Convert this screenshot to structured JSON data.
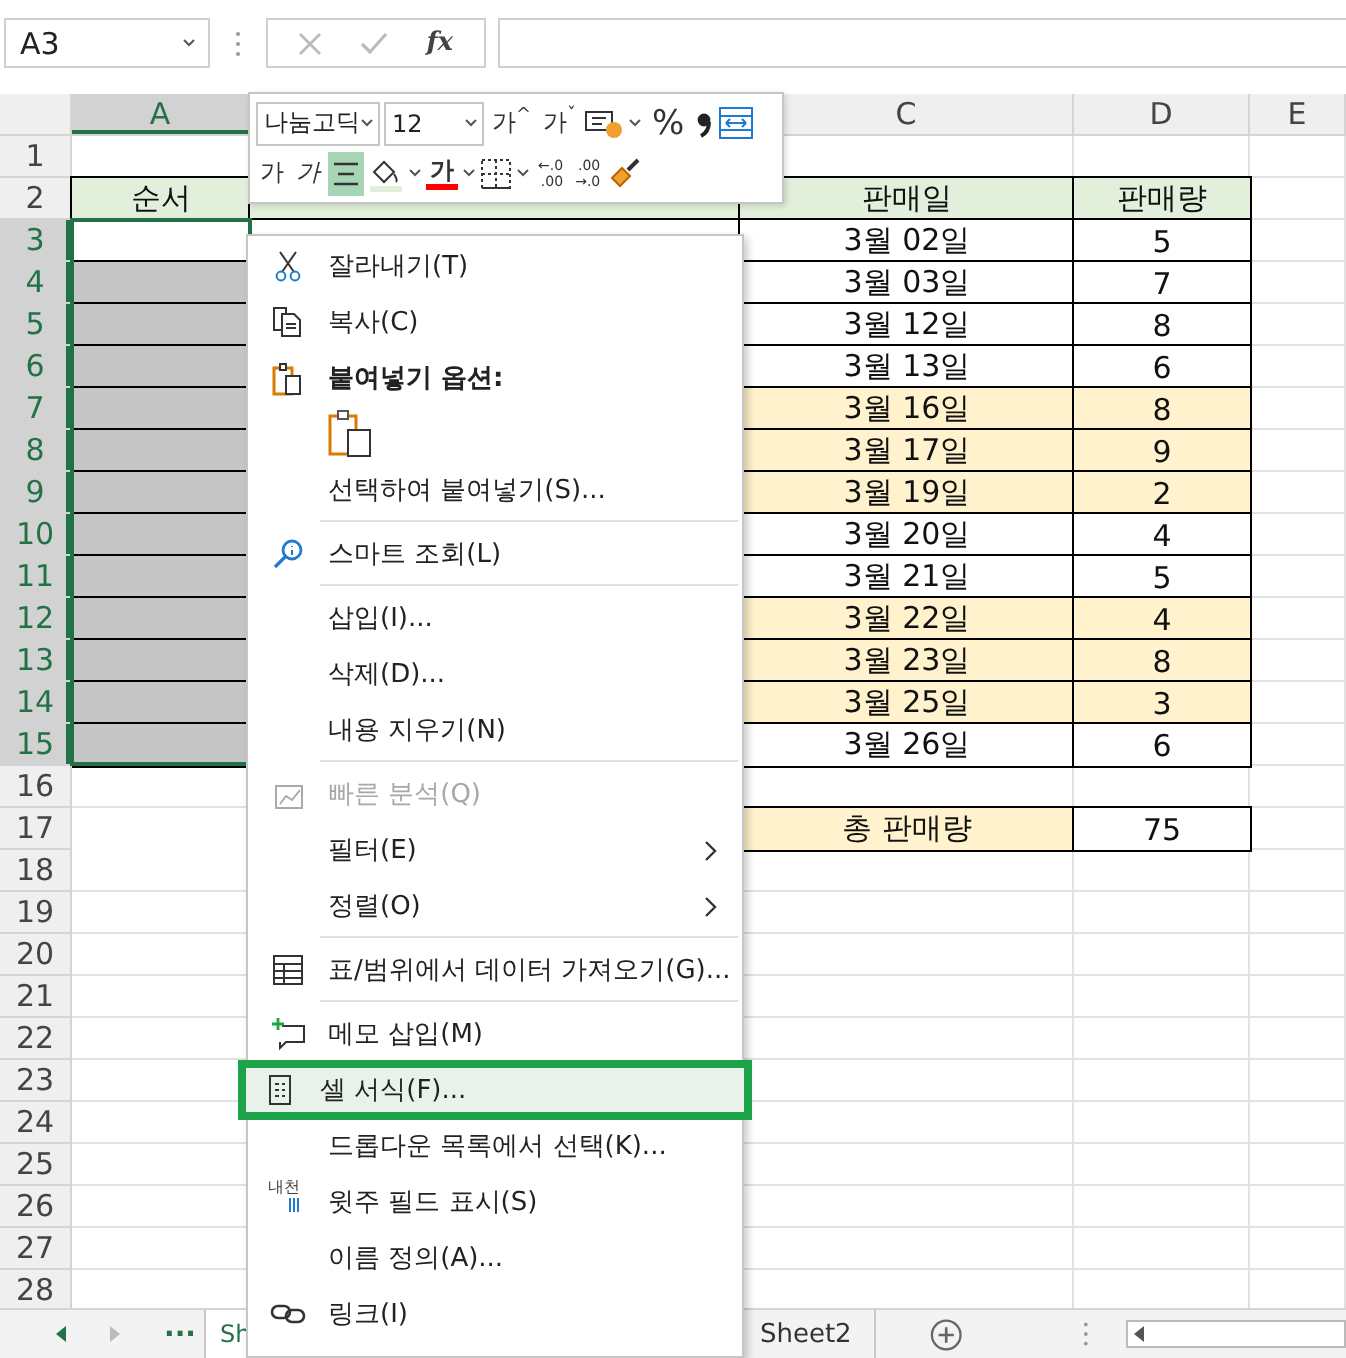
{
  "name_box": "A3",
  "formula_bar": {
    "fx_label": "fx"
  },
  "mini_toolbar": {
    "font": "나눔고딕",
    "size": "12",
    "grow_label": "가",
    "grow_mark": "^",
    "shrink_label": "가",
    "shrink_mark": "ˇ",
    "percent_label": "%",
    "bold_label": "가",
    "italic_label": "가",
    "align_center_selected": true,
    "font_color_label": "가",
    "increase_decimal": {
      "arrow": "←",
      "top": ".0",
      "bottom": ".00"
    },
    "decrease_decimal": {
      "arrow": "→",
      "top": ".00",
      "bottom": ".0"
    }
  },
  "columns": [
    {
      "label": "A",
      "selected": true
    },
    {},
    {
      "label": "C",
      "selected": false
    },
    {
      "label": "D",
      "selected": false
    },
    {
      "label": "E",
      "selected": false
    }
  ],
  "rows": [
    {
      "number": "1",
      "selected": false
    },
    {
      "number": "2",
      "selected": false,
      "cells": [
        {
          "text": "순서",
          "color": "#e2efda",
          "bordered": true
        },
        {
          "color": "#e2efda",
          "bordered": true
        },
        {
          "text": "판매일",
          "color": "#e2efda",
          "bordered": true
        },
        {
          "text": "판매량",
          "color": "#e2efda",
          "bordered": true
        }
      ]
    },
    {
      "number": "3",
      "selected": true,
      "cells": [
        {
          "color": "#ffffff",
          "bordered": true
        },
        {
          "color": "#ffffff",
          "bordered": true
        },
        {
          "text": "3월 02일",
          "color": "#ffffff",
          "bordered": true
        },
        {
          "text": "5",
          "color": "#ffffff",
          "bordered": true
        }
      ]
    },
    {
      "number": "4",
      "selected": true,
      "cells": [
        {
          "color": "#c6c6c6",
          "bordered": true
        },
        {
          "text": "3월 03일",
          "color": "#ffffff",
          "bordered": true
        },
        {
          "text": "7",
          "color": "#ffffff",
          "bordered": true
        }
      ]
    },
    {
      "number": "5",
      "selected": true,
      "cells": [
        {
          "color": "#c6c6c6",
          "bordered": true
        },
        {
          "text": "3월 12일",
          "color": "#ffffff",
          "bordered": true
        },
        {
          "text": "8",
          "color": "#ffffff",
          "bordered": true
        }
      ]
    },
    {
      "number": "6",
      "selected": true,
      "cells": [
        {
          "color": "#c6c6c6",
          "bordered": true
        },
        {
          "text": "3월 13일",
          "color": "#ffffff",
          "bordered": true
        },
        {
          "text": "6",
          "color": "#ffffff",
          "bordered": true
        }
      ]
    },
    {
      "number": "7",
      "selected": true,
      "cells": [
        {
          "color": "#c6c6c6",
          "bordered": true
        },
        {
          "text": "3월 16일",
          "color": "#fff2cc",
          "bordered": true
        },
        {
          "text": "8",
          "color": "#fff2cc",
          "bordered": true
        }
      ]
    },
    {
      "number": "8",
      "selected": true,
      "cells": [
        {
          "color": "#c6c6c6",
          "bordered": true
        },
        {
          "text": "3월 17일",
          "color": "#fff2cc",
          "bordered": true
        },
        {
          "text": "9",
          "color": "#fff2cc",
          "bordered": true
        }
      ]
    },
    {
      "number": "9",
      "selected": true,
      "cells": [
        {
          "color": "#c6c6c6",
          "bordered": true
        },
        {
          "text": "3월 19일",
          "color": "#fff2cc",
          "bordered": true
        },
        {
          "text": "2",
          "color": "#fff2cc",
          "bordered": true
        }
      ]
    },
    {
      "number": "10",
      "selected": true,
      "cells": [
        {
          "color": "#c6c6c6",
          "bordered": true
        },
        {
          "text": "3월 20일",
          "color": "#ffffff",
          "bordered": true
        },
        {
          "text": "4",
          "color": "#ffffff",
          "bordered": true
        }
      ]
    },
    {
      "number": "11",
      "selected": true,
      "cells": [
        {
          "color": "#c6c6c6",
          "bordered": true
        },
        {
          "text": "3월 21일",
          "color": "#ffffff",
          "bordered": true
        },
        {
          "text": "5",
          "color": "#ffffff",
          "bordered": true
        }
      ]
    },
    {
      "number": "12",
      "selected": true,
      "cells": [
        {
          "color": "#c6c6c6",
          "bordered": true
        },
        {
          "text": "3월 22일",
          "color": "#fff2cc",
          "bordered": true
        },
        {
          "text": "4",
          "color": "#fff2cc",
          "bordered": true
        }
      ]
    },
    {
      "number": "13",
      "selected": true,
      "cells": [
        {
          "color": "#c6c6c6",
          "bordered": true
        },
        {
          "text": "3월 23일",
          "color": "#fff2cc",
          "bordered": true
        },
        {
          "text": "8",
          "color": "#fff2cc",
          "bordered": true
        }
      ]
    },
    {
      "number": "14",
      "selected": true,
      "cells": [
        {
          "color": "#c6c6c6",
          "bordered": true
        },
        {
          "text": "3월 25일",
          "color": "#fff2cc",
          "bordered": true
        },
        {
          "text": "3",
          "color": "#fff2cc",
          "bordered": true
        }
      ]
    },
    {
      "number": "15",
      "selected": true,
      "cells": [
        {
          "color": "#c6c6c6",
          "bordered": true
        },
        {
          "text": "3월 26일",
          "color": "#ffffff",
          "bordered": true
        },
        {
          "text": "6",
          "color": "#ffffff",
          "bordered": true
        }
      ]
    },
    {
      "number": "16",
      "selected": false
    },
    {
      "number": "17",
      "selected": false,
      "cells": [
        {
          "color": "#ffffff",
          "bordered": false
        },
        {
          "text": "총 판매량",
          "color": "#fff2cc",
          "bordered": true
        },
        {
          "text": "75",
          "color": "#ffffff",
          "bordered": true
        }
      ]
    },
    {
      "number": "18",
      "selected": false
    },
    {
      "number": "19",
      "selected": false
    },
    {
      "number": "20",
      "selected": false
    },
    {
      "number": "21",
      "selected": false
    },
    {
      "number": "22",
      "selected": false
    },
    {
      "number": "23",
      "selected": false
    },
    {
      "number": "24",
      "selected": false
    },
    {
      "number": "25",
      "selected": false
    },
    {
      "number": "26",
      "selected": false
    },
    {
      "number": "27",
      "selected": false
    },
    {
      "number": "28",
      "selected": false
    }
  ],
  "context_menu": [
    {
      "kind": "item",
      "label": "잘라내기(T)",
      "disabled": false,
      "submenu": false,
      "selected": false
    },
    {
      "kind": "item",
      "label": "복사(C)",
      "disabled": false,
      "submenu": false,
      "selected": false
    },
    {
      "kind": "header",
      "label": "붙여넣기 옵션:"
    },
    {
      "kind": "paste-options"
    },
    {
      "kind": "item",
      "label": "선택하여 붙여넣기(S)...",
      "disabled": false,
      "submenu": false,
      "selected": false
    },
    {
      "kind": "separator"
    },
    {
      "kind": "item",
      "label": "스마트 조회(L)",
      "disabled": false,
      "submenu": false,
      "selected": false
    },
    {
      "kind": "separator"
    },
    {
      "kind": "item",
      "label": "삽입(I)...",
      "disabled": false,
      "submenu": false,
      "selected": false
    },
    {
      "kind": "item",
      "label": "삭제(D)...",
      "disabled": false,
      "submenu": false,
      "selected": false
    },
    {
      "kind": "item",
      "label": "내용 지우기(N)",
      "disabled": false,
      "submenu": false,
      "selected": false
    },
    {
      "kind": "separator"
    },
    {
      "kind": "item",
      "label": "빠른 분석(Q)",
      "disabled": true,
      "submenu": false,
      "selected": false
    },
    {
      "kind": "item",
      "label": "필터(E)",
      "disabled": false,
      "submenu": true,
      "selected": false
    },
    {
      "kind": "item",
      "label": "정렬(O)",
      "disabled": false,
      "submenu": true,
      "selected": false
    },
    {
      "kind": "separator"
    },
    {
      "kind": "item",
      "label": "표/범위에서 데이터 가져오기(G)...",
      "disabled": false,
      "submenu": false,
      "selected": false
    },
    {
      "kind": "separator"
    },
    {
      "kind": "item",
      "label": "메모 삽입(M)",
      "disabled": false,
      "submenu": false,
      "selected": false
    },
    {
      "kind": "item",
      "label": "셀 서식(F)...",
      "disabled": false,
      "submenu": false,
      "selected": true
    },
    {
      "kind": "item",
      "label": "드롭다운 목록에서 선택(K)...",
      "disabled": false,
      "submenu": false,
      "selected": false
    },
    {
      "kind": "item",
      "icon_label": "내천",
      "label": "윗주 필드 표시(S)",
      "disabled": false,
      "submenu": false,
      "selected": false
    },
    {
      "kind": "item",
      "label": "이름 정의(A)...",
      "disabled": false,
      "submenu": false,
      "selected": false
    },
    {
      "kind": "item",
      "label": "링크(I)",
      "disabled": false,
      "submenu": false,
      "selected": false
    }
  ],
  "sheet_tabs": {
    "more_label": "...",
    "tabs": [
      {
        "label": "Sh",
        "selected": true
      },
      {
        "label": "Sheet2",
        "selected": false
      }
    ]
  }
}
